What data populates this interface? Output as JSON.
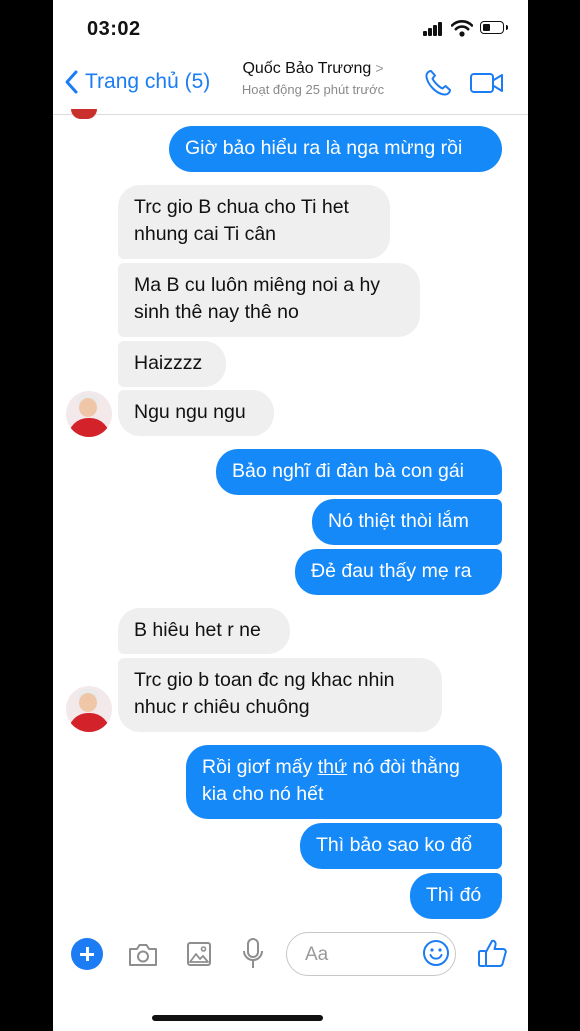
{
  "status_bar": {
    "time": "03:02"
  },
  "header": {
    "back_label": "Trang chủ (5)",
    "contact_name": "Quốc Bảo Trương",
    "activity": "Hoạt động 25 phút trước"
  },
  "messages": [
    {
      "from": "me",
      "lines": [
        "Giờ bảo hiểu ra là nga mừng rồi"
      ]
    },
    {
      "from": "them",
      "lines": [
        "Trc gio B chua cho Ti het",
        "nhung cai Ti cân"
      ]
    },
    {
      "from": "them",
      "lines": [
        "Ma B cu luôn miêng noi a hy",
        "sinh thê nay thê no"
      ]
    },
    {
      "from": "them",
      "lines": [
        "Haizzzz"
      ]
    },
    {
      "from": "them",
      "lines": [
        "Ngu ngu ngu"
      ]
    },
    {
      "from": "me",
      "lines": [
        "Bảo nghĩ đi đàn bà con gái"
      ]
    },
    {
      "from": "me",
      "lines": [
        "Nó thiệt thòi lắm"
      ]
    },
    {
      "from": "me",
      "lines": [
        "Đẻ đau thấy mẹ ra"
      ]
    },
    {
      "from": "them",
      "lines": [
        "B hiêu het r ne"
      ]
    },
    {
      "from": "them",
      "lines": [
        "Trc gio b toan đc ng khac nhin",
        "nhuc r chiêu chuông"
      ]
    },
    {
      "from": "me",
      "line1_start": "Rồi giơf mấy ",
      "line1_underlined": "thứ",
      "line1_end": " nó đòi thằng",
      "line2": "kia cho nó hết"
    },
    {
      "from": "me",
      "lines": [
        "Thì bảo sao ko đổ"
      ]
    },
    {
      "from": "me",
      "lines": [
        "Thì đó"
      ]
    }
  ],
  "composer": {
    "placeholder": "Aa"
  },
  "colors": {
    "accent": "#1b7cf3",
    "outgoing_bubble": "#1689f9",
    "incoming_bubble": "#efefef"
  },
  "icons": [
    "back-chevron-icon",
    "phone-icon",
    "video-camera-icon",
    "plus-icon",
    "camera-icon",
    "gallery-icon",
    "microphone-icon",
    "emoji-icon",
    "thumbs-up-icon"
  ]
}
